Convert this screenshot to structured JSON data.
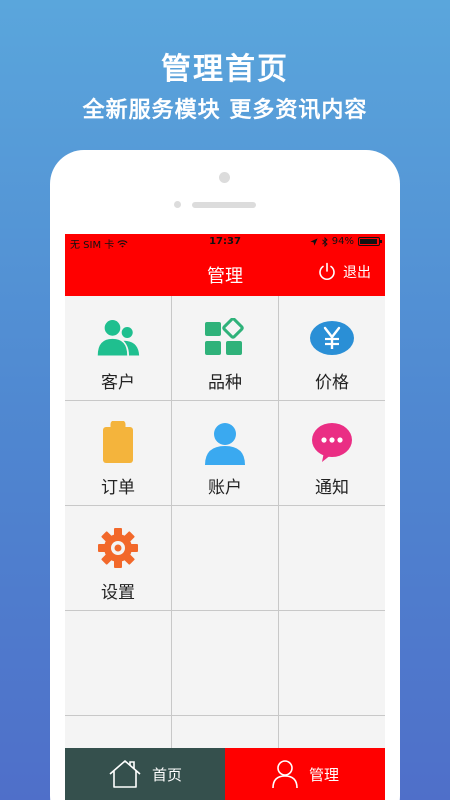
{
  "promo": {
    "title": "管理首页",
    "subtitle": "全新服务模块  更多资讯内容"
  },
  "status_bar": {
    "carrier": "无 SIM 卡",
    "time": "17:37",
    "battery_text": "94%",
    "battery_level": 0.94
  },
  "nav": {
    "title": "管理",
    "logout_label": "退出"
  },
  "grid": {
    "items": [
      {
        "label": "客户",
        "icon": "customers-icon"
      },
      {
        "label": "品种",
        "icon": "categories-icon"
      },
      {
        "label": "价格",
        "icon": "yen-price-icon"
      },
      {
        "label": "订单",
        "icon": "clipboard-order-icon"
      },
      {
        "label": "账户",
        "icon": "account-user-icon"
      },
      {
        "label": "通知",
        "icon": "chat-bubble-icon"
      },
      {
        "label": "设置",
        "icon": "gear-icon"
      }
    ]
  },
  "tabs": [
    {
      "label": "首页",
      "icon": "house-icon"
    },
    {
      "label": "管理",
      "icon": "user-outline-icon"
    }
  ],
  "colors": {
    "brand_red": "#ff0000",
    "tab_home_bg": "#35504d",
    "customers_green": "#1fbf8f",
    "categories_green": "#2fb27a",
    "price_blue": "#2a8fd6",
    "order_orange": "#f4b43c",
    "account_blue": "#3aa9f0",
    "notify_pink": "#ea2e84",
    "settings_orange": "#f2682a"
  }
}
